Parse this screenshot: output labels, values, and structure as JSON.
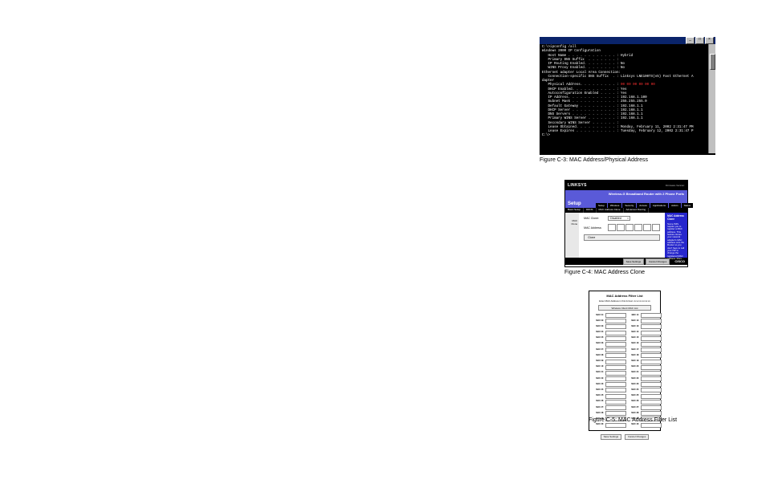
{
  "fig1": {
    "caption": "Figure C-3: MAC Address/Physical Address",
    "window_buttons": [
      "_",
      "□",
      "×"
    ],
    "highlight": "00 00 00 00 00 00",
    "lines_pre": [
      "C:\\>ipconfig /all",
      "",
      "Windows 2000 IP Configuration",
      "",
      "   Host Name . . . . . . . . . . . . : Hybrid",
      "   Primary DNS Suffix  . . . . . . . :",
      "   IP Routing Enabled. . . . . . . . : No",
      "   WINS Proxy Enabled. . . . . . . . : No",
      "",
      "Ethernet adapter Local Area Connection:",
      "",
      "   Connection-specific DNS Suffix  . : Linksys LNE100TX(v5) Fast Ethernet A",
      "dapter"
    ],
    "phys_label": "   Physical Address. . . . . . . . . : ",
    "lines_post": [
      "   DHCP Enabled. . . . . . . . . . . : Yes",
      "   Autoconfiguration Enabled . . . . : Yes",
      "   IP Address. . . . . . . . . . . . : 192.168.1.100",
      "   Subnet Mask . . . . . . . . . . . : 255.255.255.0",
      "   Default Gateway . . . . . . . . . : 192.168.1.1",
      "   DHCP Server . . . . . . . . . . . : 192.168.1.1",
      "   DNS Servers . . . . . . . . . . . : 192.168.1.1",
      "   Primary WINS Server . . . . . . . : 192.168.1.1",
      "   Secondary WINS Server . . . . . . :",
      "   Lease Obtained. . . . . . . . . . : Monday, February 11, 2002 2:31:47 PM",
      "",
      "   Lease Expires . . . . . . . . . . : Tuesday, February 12, 2002 2:31:47 P",
      "",
      "C:\\>"
    ]
  },
  "fig2": {
    "caption": "Figure C-4: MAC Address Clone",
    "logo": "LINKSYS",
    "fw": "Firmware Version:",
    "banner": "Wireless-G Broadband Router with 2 Phone Ports",
    "setup": "Setup",
    "tabs": [
      "Setup",
      "Wireless",
      "Security",
      "Access",
      "Applications",
      "Admin",
      "Status"
    ],
    "subtabs": [
      "Basic Setup",
      "DDNS",
      "MAC Address Clone",
      "Advanced Routing"
    ],
    "side": "MAC Clone",
    "row1_label": "MAC Clone:",
    "row1_value": "Disabled",
    "row2_label": "MAC Address:",
    "enter": "Clone",
    "help_h": "MAC Address Clone",
    "help": "Some ISPs require you to register a MAC address. This feature clones your network adapter's MAC address onto the Router so you don't have to call your ISP to change the registered MAC address. More...",
    "foot1": "Save Settings",
    "foot2": "Cancel Changes",
    "foot_logo": "CISCO"
  },
  "fig3": {
    "caption": "Figure C-5: MAC Address Filter List",
    "title": "MAC Address Filter List",
    "sub": "Enter MAC Address in this format: xx:xx:xx:xx:xx:xx",
    "client_btn": "Wireless Client MAC List",
    "rows": [
      [
        "MAC 01:",
        "MAC 11:"
      ],
      [
        "MAC 02:",
        "MAC 12:"
      ],
      [
        "MAC 03:",
        "MAC 13:"
      ],
      [
        "MAC 04:",
        "MAC 14:"
      ],
      [
        "MAC 05:",
        "MAC 15:"
      ],
      [
        "MAC 06:",
        "MAC 16:"
      ],
      [
        "MAC 07:",
        "MAC 17:"
      ],
      [
        "MAC 08:",
        "MAC 18:"
      ],
      [
        "MAC 09:",
        "MAC 19:"
      ],
      [
        "MAC 10:",
        "MAC 20:"
      ],
      [
        "MAC 21:",
        "MAC 31:"
      ],
      [
        "MAC 22:",
        "MAC 32:"
      ],
      [
        "MAC 23:",
        "MAC 33:"
      ],
      [
        "MAC 24:",
        "MAC 34:"
      ],
      [
        "MAC 25:",
        "MAC 35:"
      ],
      [
        "MAC 26:",
        "MAC 36:"
      ],
      [
        "MAC 27:",
        "MAC 37:"
      ],
      [
        "MAC 28:",
        "MAC 38:"
      ],
      [
        "MAC 29:",
        "MAC 39:"
      ],
      [
        "MAC 30:",
        "MAC 40:"
      ]
    ],
    "btn1": "Save Settings",
    "btn2": "Cancel Changes"
  }
}
